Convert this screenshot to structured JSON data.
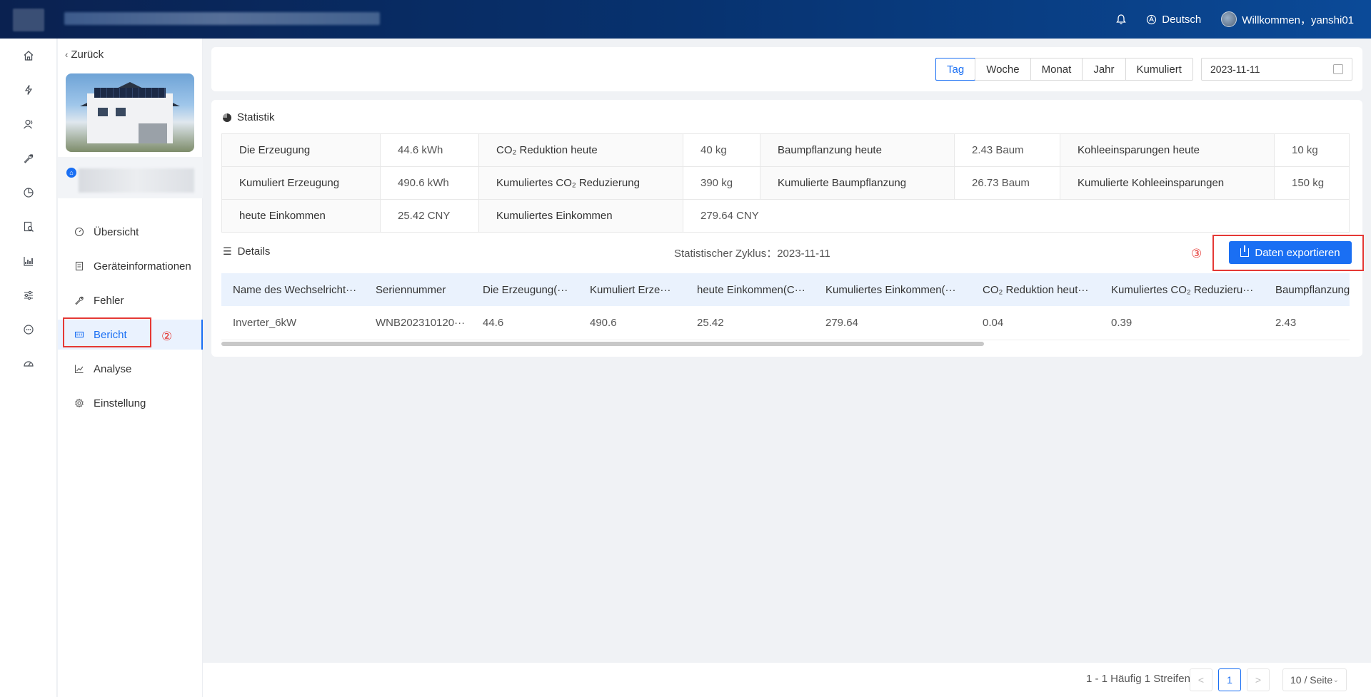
{
  "topbar": {
    "language": "Deutsch",
    "welcome": "Willkommen，yanshi01",
    "icons": [
      "bell-icon",
      "language-icon",
      "avatar"
    ]
  },
  "rail": {
    "icons": [
      "home-icon",
      "lightning-icon",
      "users-icon",
      "wrench-icon",
      "pie-chart-icon",
      "search-report-icon",
      "bar-chart-icon",
      "sliders-icon",
      "chat-icon",
      "gauge-icon"
    ]
  },
  "subnav": {
    "back": "Zurück",
    "items": [
      {
        "label": "Übersicht",
        "icon": "dashboard-icon"
      },
      {
        "label": "Geräteinformationen",
        "icon": "device-icon"
      },
      {
        "label": "Fehler",
        "icon": "wrench-icon"
      },
      {
        "label": "Bericht",
        "icon": "report-icon"
      },
      {
        "label": "Analyse",
        "icon": "line-chart-icon"
      },
      {
        "label": "Einstellung",
        "icon": "gear-icon"
      }
    ],
    "active": "Bericht"
  },
  "annotations": {
    "two": "②",
    "three": "③"
  },
  "filter": {
    "segments": [
      "Tag",
      "Woche",
      "Monat",
      "Jahr",
      "Kumuliert"
    ],
    "active": "Tag",
    "date": "2023-11-11"
  },
  "statistik": {
    "title": "Statistik",
    "rows": [
      [
        "Die Erzeugung",
        "44.6 kWh",
        "CO₂ Reduktion heute",
        "40 kg",
        "Baumpflanzung heute",
        "2.43 Baum",
        "Kohleeinsparungen heute",
        "10 kg"
      ],
      [
        "Kumuliert Erzeugung",
        "490.6 kWh",
        "Kumuliertes CO₂ Reduzierung",
        "390 kg",
        "Kumulierte Baumpflanzung",
        "26.73 Baum",
        "Kumulierte Kohleeinsparungen",
        "150 kg"
      ],
      [
        "heute Einkommen",
        "25.42 CNY",
        "Kumuliertes Einkommen",
        "279.64 CNY"
      ]
    ]
  },
  "details": {
    "title": "Details",
    "cycle_label": "Statistischer Zyklus",
    "cycle_sep": "：",
    "cycle_value": "2023-11-11",
    "export": "Daten exportieren",
    "columns": [
      "Name des Wechselricht···",
      "Seriennummer",
      "Die Erzeugung(···",
      "Kumuliert Erze···",
      "heute Einkommen(C···",
      "Kumuliertes Einkommen(···",
      "CO₂ Reduktion heut···",
      "Kumuliertes CO₂ Reduzieru···",
      "Baumpflanzung"
    ],
    "rows": [
      [
        "Inverter_6kW",
        "WNB202310120···",
        "44.6",
        "490.6",
        "25.42",
        "279.64",
        "0.04",
        "0.39",
        "2.43"
      ]
    ]
  },
  "pagination": {
    "summary": "1 - 1 Häufig 1 Streifen",
    "prev": "<",
    "page": "1",
    "next": ">",
    "page_size": "10 / Seite"
  }
}
